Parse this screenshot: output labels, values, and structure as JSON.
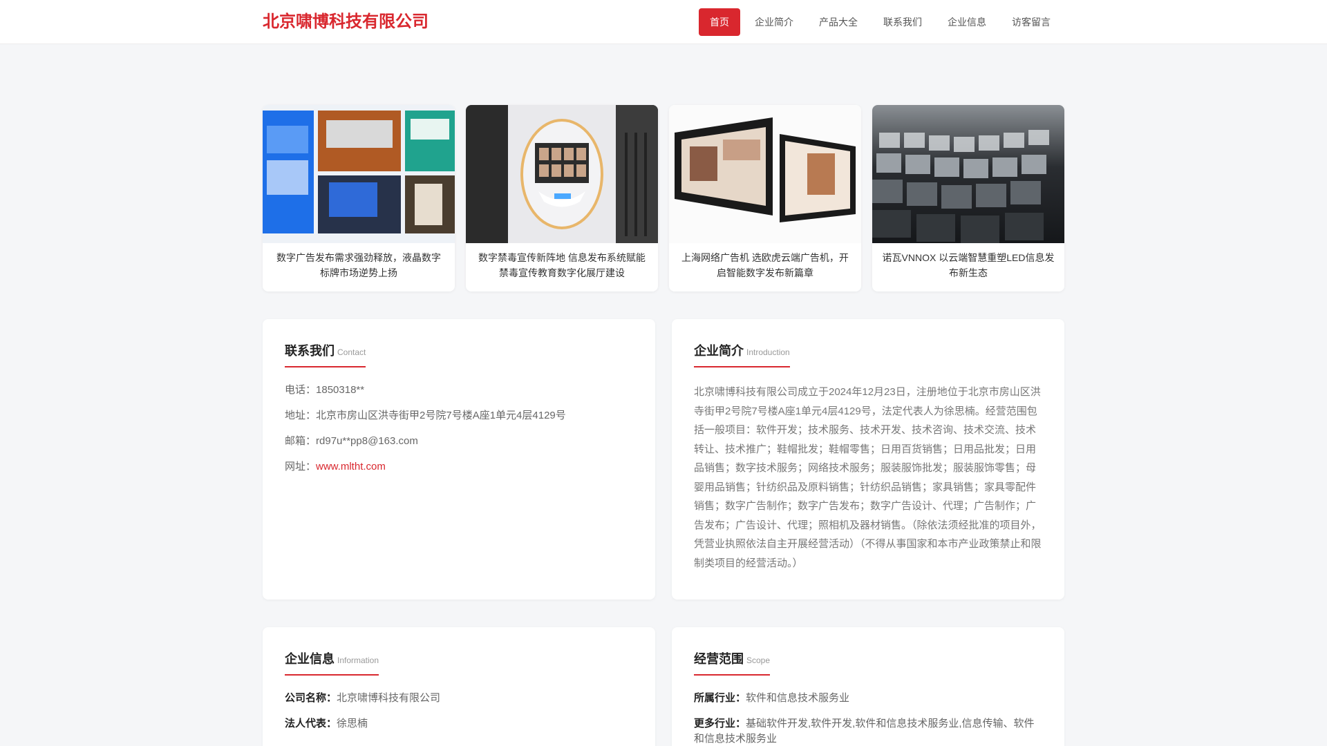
{
  "header": {
    "logo": "北京啸博科技有限公司",
    "nav": [
      "首页",
      "企业简介",
      "产品大全",
      "联系我们",
      "企业信息",
      "访客留言"
    ],
    "active_index": 0
  },
  "cards": [
    {
      "title": "数字广告发布需求强劲释放，液晶数字标牌市场逆势上扬"
    },
    {
      "title": "数字禁毒宣传新阵地 信息发布系统赋能禁毒宣传教育数字化展厅建设"
    },
    {
      "title": "上海网络广告机 选欧虎云端广告机，开启智能数字发布新篇章"
    },
    {
      "title": "诺瓦VNNOX 以云端智慧重塑LED信息发布新生态"
    }
  ],
  "contact": {
    "title": "联系我们",
    "subtitle": "Contact",
    "phone_label": "电话：",
    "phone": "1850318**",
    "address_label": "地址：",
    "address": "北京市房山区洪寺街甲2号院7号楼A座1单元4层4129号",
    "email_label": "邮箱：",
    "email": "rd97u**pp8@163.com",
    "website_label": "网址：",
    "website": "www.mltht.com"
  },
  "intro": {
    "title": "企业简介",
    "subtitle": "Introduction",
    "text": "北京啸博科技有限公司成立于2024年12月23日，注册地位于北京市房山区洪寺街甲2号院7号楼A座1单元4层4129号，法定代表人为徐思楠。经营范围包括一般项目：软件开发；技术服务、技术开发、技术咨询、技术交流、技术转让、技术推广；鞋帽批发；鞋帽零售；日用百货销售；日用品批发；日用品销售；数字技术服务；网络技术服务；服装服饰批发；服装服饰零售；母婴用品销售；针纺织品及原料销售；针纺织品销售；家具销售；家具零配件销售；数字广告制作；数字广告发布；数字广告设计、代理；广告制作；广告发布；广告设计、代理；照相机及器材销售。（除依法须经批准的项目外，凭营业执照依法自主开展经营活动）（不得从事国家和本市产业政策禁止和限制类项目的经营活动。）"
  },
  "info": {
    "title": "企业信息",
    "subtitle": "Information",
    "company_label": "公司名称：",
    "company": "北京啸博科技有限公司",
    "legal_label": "法人代表：",
    "legal": "徐思楠"
  },
  "scope": {
    "title": "经营范围",
    "subtitle": "Scope",
    "industry_label": "所属行业：",
    "industry": "软件和信息技术服务业",
    "more_label": "更多行业：",
    "more": "基础软件开发,软件开发,软件和信息技术服务业,信息传输、软件和信息技术服务业"
  },
  "colors": {
    "accent": "#d9272e",
    "background": "#f5f6f8"
  }
}
